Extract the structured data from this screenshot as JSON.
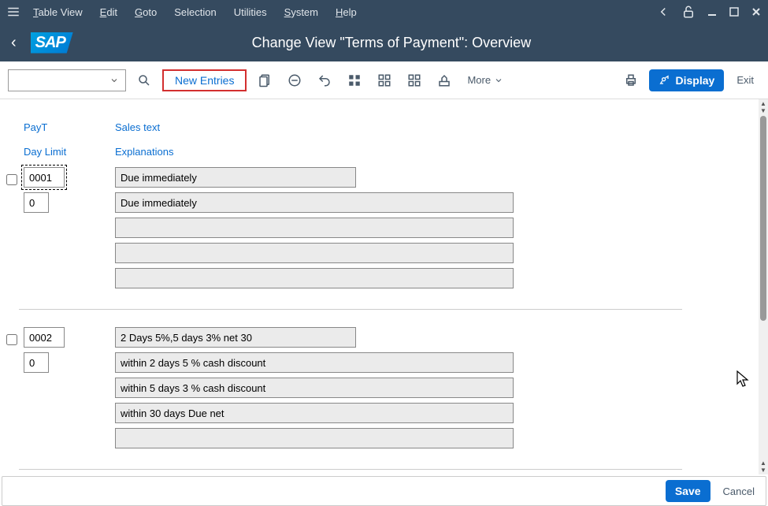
{
  "menu": {
    "table_view": "Table View",
    "edit": "Edit",
    "goto": "Goto",
    "selection": "Selection",
    "utilities": "Utilities",
    "system": "System",
    "help": "Help"
  },
  "page_title": "Change View \"Terms of Payment\": Overview",
  "toolbar": {
    "new_entries": "New Entries",
    "more": "More",
    "display": "Display",
    "exit": "Exit"
  },
  "headers": {
    "payt": "PayT",
    "sales_text": "Sales text",
    "day_limit": "Day Limit",
    "explanations": "Explanations"
  },
  "entries": [
    {
      "checked": false,
      "payt": "0001",
      "day_limit": "0",
      "sales_text": "Due immediately",
      "expl": [
        "Due immediately",
        "",
        "",
        ""
      ]
    },
    {
      "checked": false,
      "payt": "0002",
      "day_limit": "0",
      "sales_text": "2 Days 5%,5 days 3% net 30",
      "expl": [
        "within 2 days 5 % cash discount",
        "within 5 days 3 % cash discount",
        "within 30 days Due net",
        ""
      ]
    }
  ],
  "footer": {
    "save": "Save",
    "cancel": "Cancel"
  }
}
